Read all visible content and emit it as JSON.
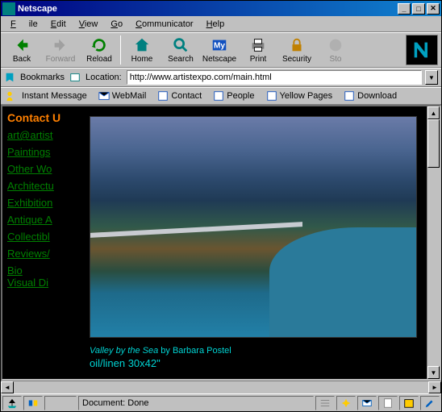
{
  "window": {
    "title": "Netscape"
  },
  "menu": {
    "items": [
      "File",
      "Edit",
      "View",
      "Go",
      "Communicator",
      "Help"
    ]
  },
  "toolbar": {
    "items": [
      {
        "label": "Back",
        "icon": "back-icon",
        "color": "#008000"
      },
      {
        "label": "Forward",
        "icon": "forward-icon",
        "color": "#808080"
      },
      {
        "label": "Reload",
        "icon": "reload-icon",
        "color": "#008000"
      },
      {
        "label": "Home",
        "icon": "home-icon",
        "color": "#008080"
      },
      {
        "label": "Search",
        "icon": "search-icon",
        "color": "#008080"
      },
      {
        "label": "Netscape",
        "icon": "netscape-icon",
        "color": "#1050c0"
      },
      {
        "label": "Print",
        "icon": "print-icon",
        "color": "#808080"
      },
      {
        "label": "Security",
        "icon": "security-icon",
        "color": "#c08000"
      },
      {
        "label": "Sto",
        "icon": "stop-icon",
        "color": "#808080"
      }
    ]
  },
  "location": {
    "bookmarks_label": "Bookmarks",
    "label": "Location:",
    "url": "http://www.artistexpo.com/main.html"
  },
  "personal": {
    "items": [
      "Instant Message",
      "WebMail",
      "Contact",
      "People",
      "Yellow Pages",
      "Download"
    ]
  },
  "sidebar": {
    "heading": "Contact U",
    "email": "art@artist",
    "links": [
      "Paintings",
      "Other Wo",
      "Architectu",
      "Exhibition",
      "Antique A",
      "Collectibl",
      "Reviews/",
      "Bio",
      "Visual Di"
    ]
  },
  "artwork": {
    "title": "Valley by the Sea",
    "by": " by ",
    "artist": "Barbara Postel",
    "medium": "oil/linen 30x42\""
  },
  "status": {
    "text": "Document: Done"
  }
}
